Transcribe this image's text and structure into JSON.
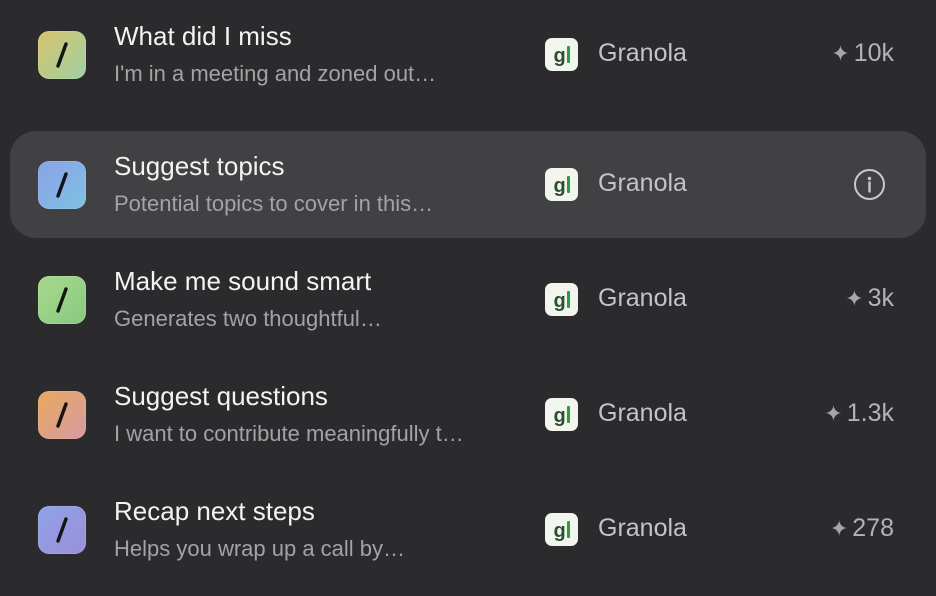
{
  "prompts": [
    {
      "title": "What did I miss",
      "subtitle": "I'm in a meeting and zoned out…",
      "app": "Granola",
      "stat_icon": "sparkle-icon",
      "stat": "10k",
      "tile_colors": [
        "#d7c36c",
        "#9fd1a3"
      ],
      "highlighted": false
    },
    {
      "title": "Suggest topics",
      "subtitle": "Potential topics to cover in this…",
      "app": "Granola",
      "stat_icon": "info-icon",
      "stat": "",
      "tile_colors": [
        "#8aa1e6",
        "#7ec2e4"
      ],
      "highlighted": true
    },
    {
      "title": "Make me sound smart",
      "subtitle": "Generates two thoughtful…",
      "app": "Granola",
      "stat_icon": "sparkle-icon",
      "stat": "3k",
      "tile_colors": [
        "#a7d98c",
        "#88c980"
      ],
      "highlighted": false
    },
    {
      "title": "Suggest questions",
      "subtitle": "I want to contribute meaningfully t…",
      "app": "Granola",
      "stat_icon": "sparkle-icon",
      "stat": "1.3k",
      "tile_colors": [
        "#e8a95c",
        "#d69aa4"
      ],
      "highlighted": false
    },
    {
      "title": "Recap next steps",
      "subtitle": "Helps you wrap up a call by…",
      "app": "Granola",
      "stat_icon": "sparkle-icon",
      "stat": "278",
      "tile_colors": [
        "#8fa3e8",
        "#9b8fd8"
      ],
      "highlighted": false
    }
  ],
  "colors": {
    "background": "#2b2b2d",
    "row_highlight": "#414143",
    "granola_green": "#2f9a3a"
  }
}
